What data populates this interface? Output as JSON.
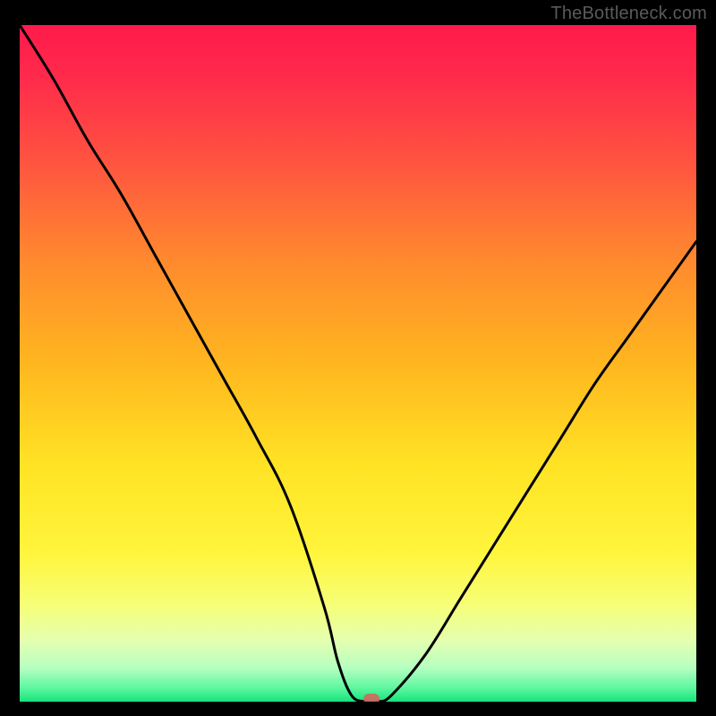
{
  "attribution": "TheBottleneck.com",
  "chart_data": {
    "type": "line",
    "title": "",
    "xlabel": "",
    "ylabel": "",
    "xlim": [
      0,
      100
    ],
    "ylim": [
      0,
      100
    ],
    "grid": false,
    "series": [
      {
        "name": "bottleneck-curve",
        "x": [
          0,
          5,
          10,
          15,
          20,
          25,
          30,
          35,
          40,
          45,
          47,
          49,
          51,
          53,
          55,
          60,
          65,
          70,
          75,
          80,
          85,
          90,
          95,
          100
        ],
        "values": [
          100,
          92,
          83,
          75,
          66,
          57,
          48,
          39,
          29,
          14,
          6,
          1,
          0,
          0,
          1,
          7,
          15,
          23,
          31,
          39,
          47,
          54,
          61,
          68
        ]
      }
    ],
    "gradient_stops": [
      {
        "offset": 0.0,
        "color": "#ff1a4b"
      },
      {
        "offset": 0.08,
        "color": "#ff2b4b"
      },
      {
        "offset": 0.2,
        "color": "#ff5340"
      },
      {
        "offset": 0.35,
        "color": "#ff8a2e"
      },
      {
        "offset": 0.5,
        "color": "#ffb61f"
      },
      {
        "offset": 0.65,
        "color": "#ffe324"
      },
      {
        "offset": 0.78,
        "color": "#fff53c"
      },
      {
        "offset": 0.86,
        "color": "#f6ff7a"
      },
      {
        "offset": 0.91,
        "color": "#e4ffb0"
      },
      {
        "offset": 0.95,
        "color": "#b6ffc0"
      },
      {
        "offset": 0.98,
        "color": "#5cf7a0"
      },
      {
        "offset": 1.0,
        "color": "#17e37a"
      }
    ],
    "marker": {
      "x": 52,
      "y": 0,
      "color": "#d9615c"
    }
  }
}
